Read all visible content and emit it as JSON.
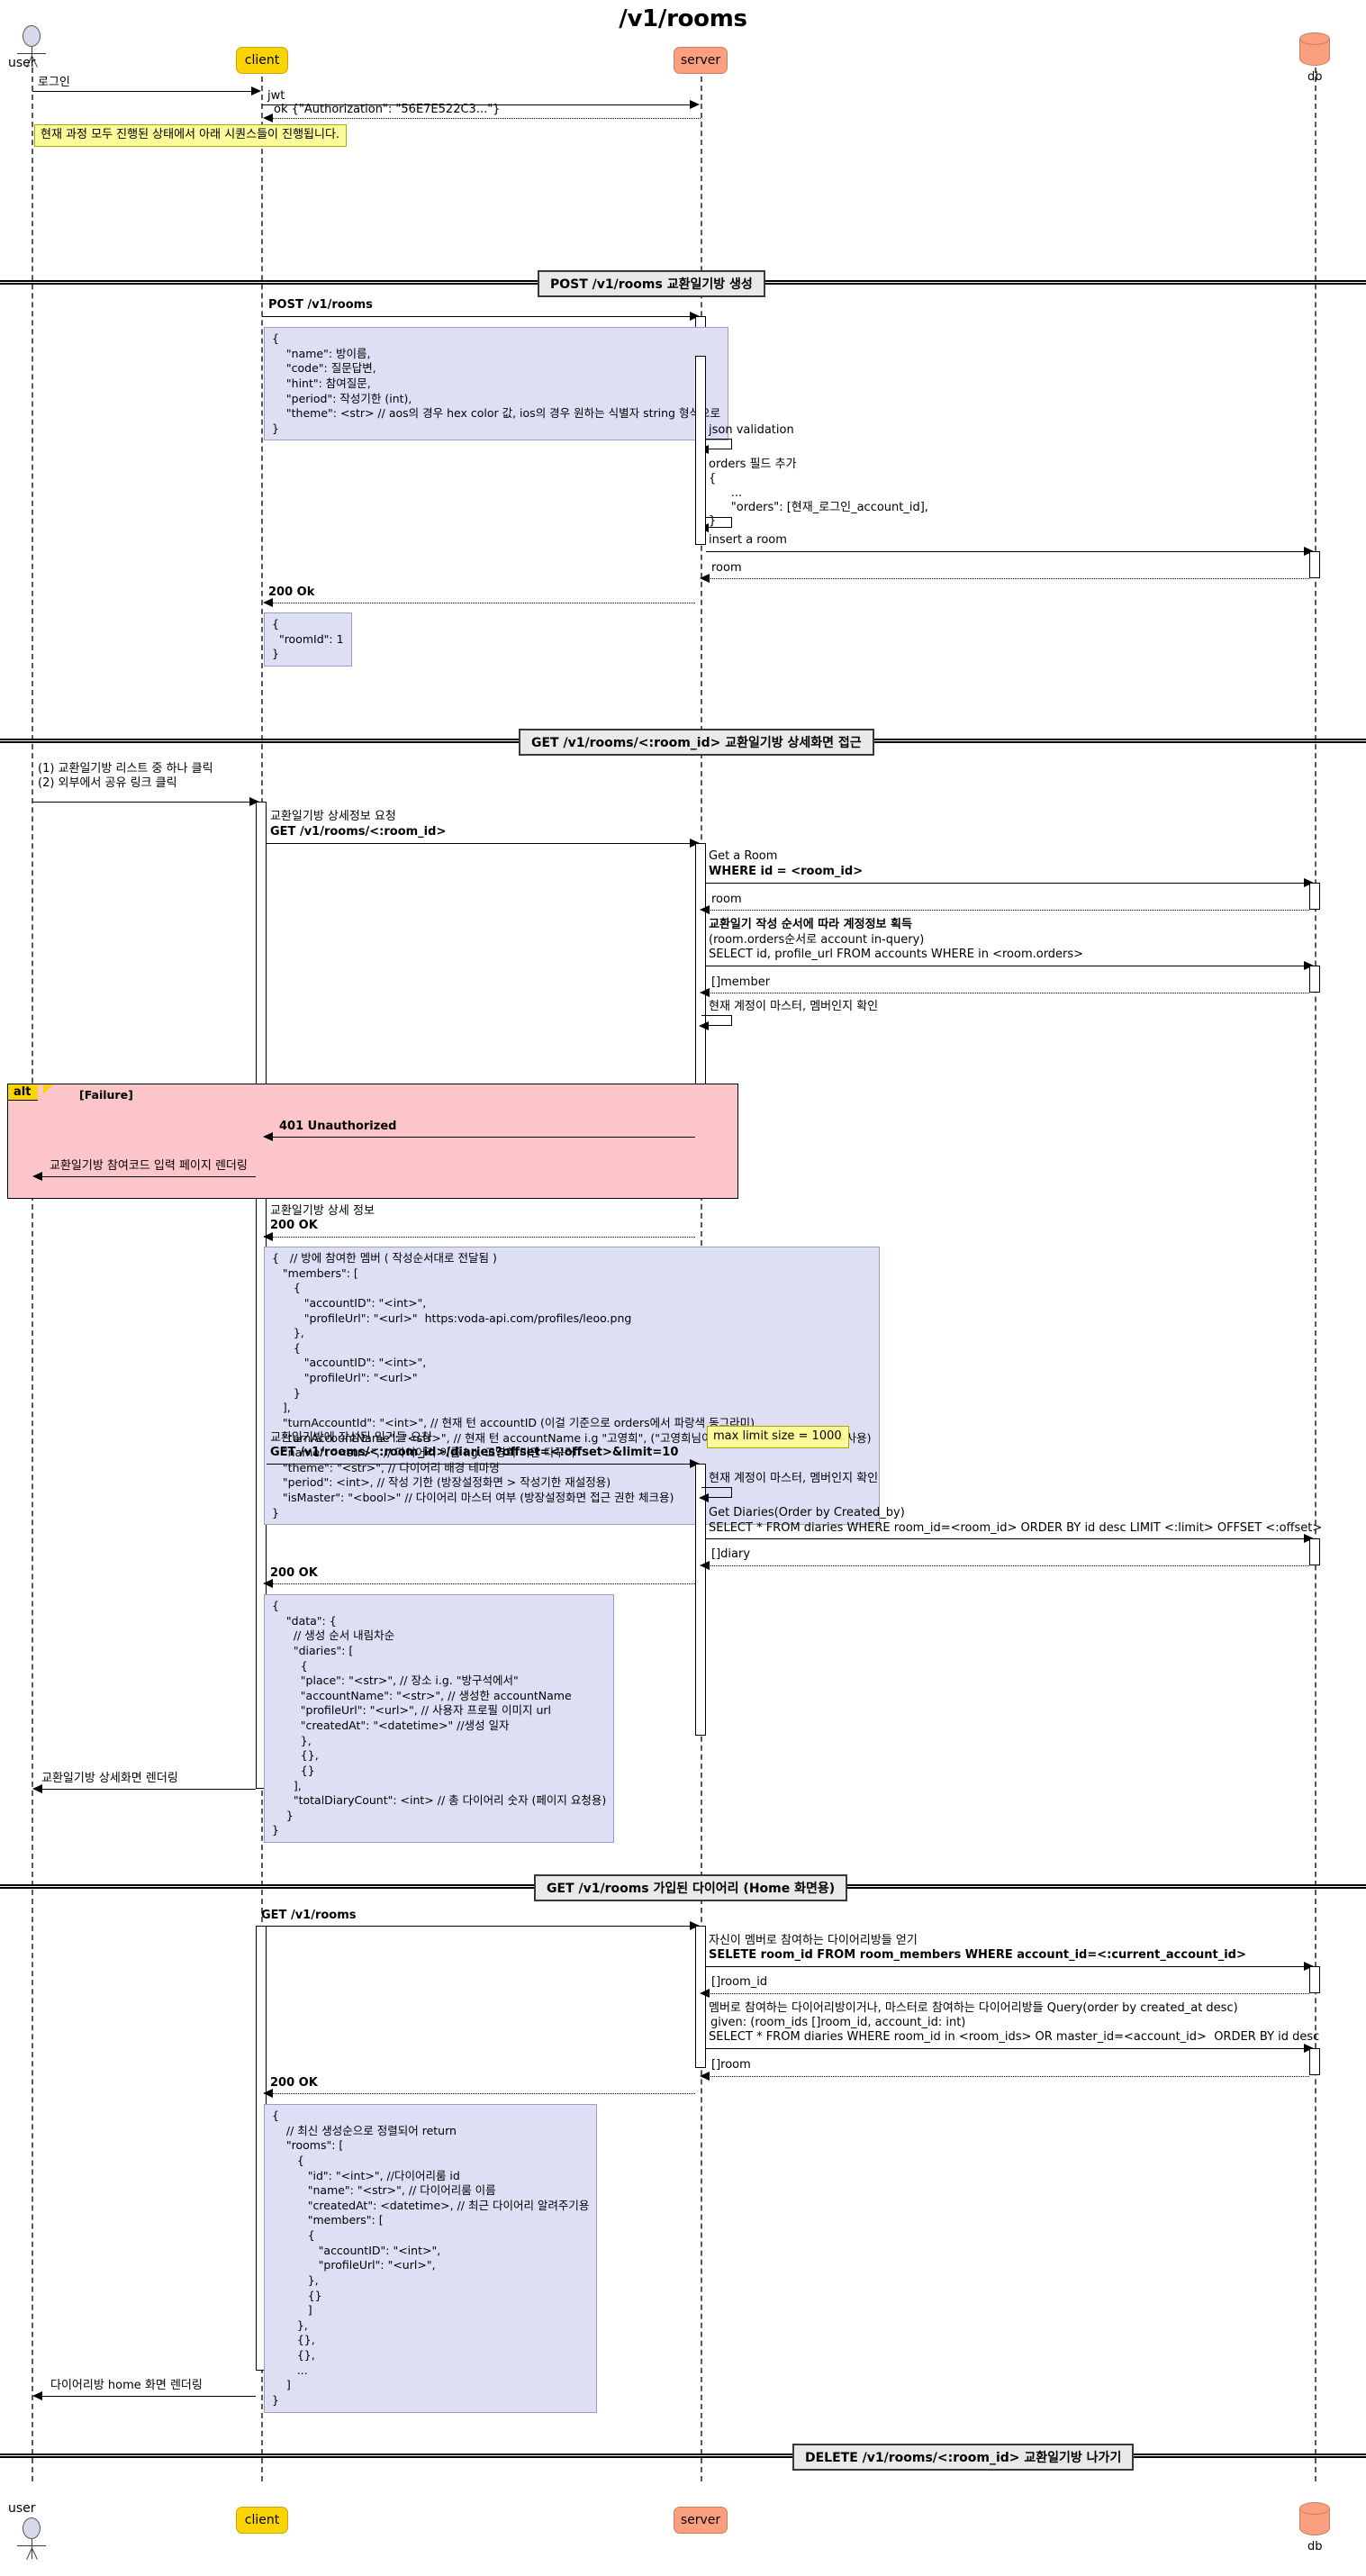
{
  "title": "/v1/rooms",
  "participants": {
    "user": {
      "name": "user",
      "type": "actor"
    },
    "client": {
      "name": "client",
      "type": "participant",
      "color": "#FCD303"
    },
    "server": {
      "name": "server",
      "type": "participant",
      "color": "#FB9F7F"
    },
    "db": {
      "name": "db",
      "type": "database",
      "color": "#FB9F7F"
    }
  },
  "login": {
    "m1": "로그인",
    "m2": "jwt",
    "m3": "ok {\"Authorization\": \"56E7E522C3...\"}",
    "note": "현재 과정 모두 진행된 상태에서 아래 시퀀스들이 진행됩니다."
  },
  "dividers": {
    "post_rooms": "POST /v1/rooms   교환일기방 생성",
    "get_room_detail": "GET /v1/rooms/<:room_id>   교환일기방 상세화면 접근",
    "get_rooms_home": "GET /v1/rooms  가입된 다이어리 (Home 화면용)",
    "delete_room": "DELETE /v1/rooms/<:room_id> 교환일기방 나가기"
  },
  "post_section": {
    "request": "POST /v1/rooms",
    "request_body": "{\n    \"name\": 방이름,\n    \"code\": 질문답변,\n    \"hint\": 참여질문,\n    \"period\": 작성기한 (int),\n    \"theme\": <str> // aos의 경우 hex color 값, ios의 경우 원하는 식별자 string 형식으로\n}",
    "self1": "json validation",
    "self2": "orders 필드 추가\n{\n      ...\n      \"orders\": [현재_로그인_account_id],\n}",
    "db_insert": "insert a room",
    "db_return": "room",
    "response": "200 Ok",
    "response_body": "{\n  \"roomId\": 1\n}"
  },
  "get_detail_section": {
    "user_action": "(1) 교환일기방 리스트 중 하나 클릭\n(2) 외부에서 공유 링크 클릭",
    "request_note": "교환일기방 상세정보 요청",
    "request": "GET /v1/rooms/<:room_id>",
    "db1_note": "Get a Room",
    "db1_query": "WHERE id = <room_id>",
    "db1_return": "room",
    "db2_note": "교환일기 작성 순서에 따라 계정정보 획득",
    "db2_sub": "(room.orders순서로 account in-query)",
    "db2_query": "SELECT id, profile_url FROM accounts WHERE in <room.orders>",
    "db2_return": "[]member",
    "self_check": "현재 계정이 마스터, 멤버인지 확인",
    "alt": {
      "label": "alt",
      "condition": "[Failure]",
      "msg1": "401 Unauthorized",
      "msg2": "교환일기방 참여코드 입력 페이지 렌더링"
    },
    "response_note": "교환일기방 상세 정보",
    "response": "200 OK",
    "response_body": "{   // 방에 참여한 멤버 ( 작성순서대로 전달됨 )\n   \"members\": [\n      {\n         \"accountID\": \"<int>\",\n         \"profileUrl\": \"<url>\"  https:voda-api.com/profiles/leoo.png\n      },\n      {\n         \"accountID\": \"<int>\",\n         \"profileUrl\": \"<url>\"\n      }\n   ],\n   \"turnAccountId\": \"<int>\", // 현재 턴 accountID (이걸 기준으로 orders에서 파랑색 동그라미)\n   \"turnAccountName\": \"<str>\", // 현재 턴 accountName i.g \"고영희\", (\"고영희님이 이야기를 쓰고있어요!\"일때 사용)\n   \"name\": \"<str>\", // 다이어리 이름 i.g. 고영희 미만 다꾸러\n   \"theme\": \"<str>\", // 다이어리 배경 테마명\n   \"period\": <int>, // 작성 기한 (방장설정화면 > 작성기한 재설정용)\n   \"isMaster\": \"<bool>\" // 다이어리 마스터 여부 (방장설정화면 접근 권한 체크용)\n}",
    "diaries_note": "교환일기방에 작성된 일기들 요청",
    "diaries_request": "GET /v1/rooms/<:room_id>/diaries?offset=<:offset>&limit=10",
    "max_limit_note": "max limit size = 1000",
    "diaries_self_check": "현재 계정이 마스터, 멤버인지 확인",
    "diaries_db_note": "Get Diaries(Order by Created_by)",
    "diaries_db_query": "SELECT * FROM diaries WHERE room_id=<room_id> ORDER BY id desc LIMIT <:limit> OFFSET <:offset>",
    "diaries_db_return": "[]diary",
    "diaries_response": "200 OK",
    "diaries_response_body": "{\n    \"data\": {\n      // 생성 순서 내림차순\n      \"diaries\": [\n        {\n        \"place\": \"<str>\", // 장소 i.g. \"방구석에서\"\n        \"accountName\": \"<str>\", // 생성한 accountName\n        \"profileUrl\": \"<url>\", // 사용자 프로필 이미지 url\n        \"createdAt\": \"<datetime>\" //생성 일자\n        },\n        {},\n        {}\n      ],\n      \"totalDiaryCount\": <int> // 총 다이어리 숫자 (페이지 요청용)\n    }\n}",
    "render": "교환일기방 상세화면 렌더링"
  },
  "get_rooms_section": {
    "request": "GET /v1/rooms",
    "db1_note": "자신이 멤버로 참여하는 다이어리방들 얻기",
    "db1_query": "SELETE room_id FROM room_members WHERE account_id=<:current_account_id>",
    "db1_return": "[]room_id",
    "db2_note": "멤버로 참여하는 다이어리방이거나, 마스터로 참여하는 다이어리방들 Query(order by created_at desc)",
    "db2_sub": "given: (room_ids []room_id, account_id: int)",
    "db2_query": "SELECT * FROM diaries WHERE room_id in <room_ids> OR master_id=<account_id>  ORDER BY id desc",
    "db2_return": "[]room",
    "response": "200 OK",
    "response_body": "{\n    // 최신 생성순으로 정렬되어 return\n    \"rooms\": [\n       {\n          \"id\": \"<int>\", //다이어리룸 id\n          \"name\": \"<str>\", // 다이어리룸 이름\n          \"createdAt\": <datetime>, // 최근 다이어리 알려주기용\n          \"members\": [\n          {\n             \"accountID\": \"<int>\",\n             \"profileUrl\": \"<url>\",\n          },\n          {}\n          ]\n       },\n       {},\n       {},\n       ...\n    ]\n}",
    "render": "다이어리방 home 화면 렌더링"
  }
}
